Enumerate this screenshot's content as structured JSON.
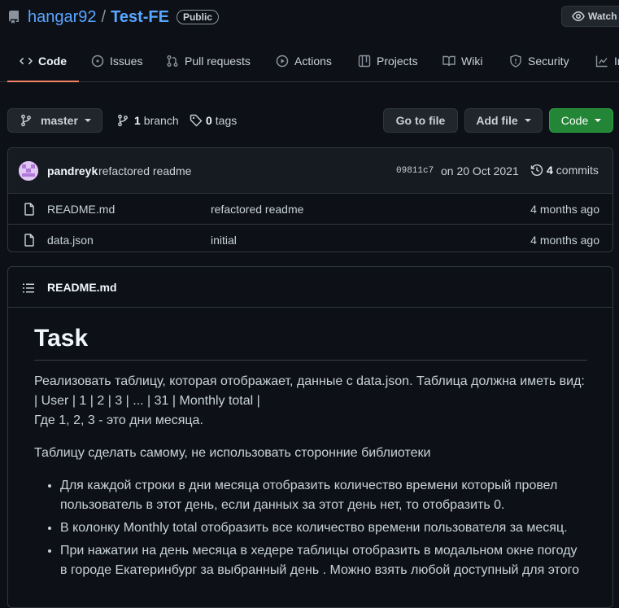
{
  "repo": {
    "owner": "hangar92",
    "separator": "/",
    "name": "Test-FE",
    "visibility": "Public",
    "watch_label": "Watch"
  },
  "tabs": [
    {
      "label": "Code",
      "icon": "code-icon",
      "active": true
    },
    {
      "label": "Issues",
      "icon": "issue-icon"
    },
    {
      "label": "Pull requests",
      "icon": "pull-request-icon"
    },
    {
      "label": "Actions",
      "icon": "play-icon"
    },
    {
      "label": "Projects",
      "icon": "project-icon"
    },
    {
      "label": "Wiki",
      "icon": "book-icon"
    },
    {
      "label": "Security",
      "icon": "shield-icon"
    },
    {
      "label": "In",
      "icon": "graph-icon"
    }
  ],
  "toolbar": {
    "branch_label": "master",
    "branch_count": "1",
    "branch_word": "branch",
    "tag_count": "0",
    "tag_word": "tags",
    "goto_label": "Go to file",
    "addfile_label": "Add file",
    "code_label": "Code"
  },
  "commit": {
    "author": "pandreyk",
    "message": "refactored readme",
    "sha": "09811c7",
    "date": "on 20 Oct 2021",
    "commit_count": "4",
    "commit_word": "commits"
  },
  "files": [
    {
      "name": "README.md",
      "message": "refactored readme",
      "age": "4 months ago"
    },
    {
      "name": "data.json",
      "message": "initial",
      "age": "4 months ago"
    }
  ],
  "readme": {
    "filename": "README.md",
    "heading": "Task",
    "p1_line1": "Реализовать таблицу, которая отображает, данные с data.json. Таблица должна иметь вид:",
    "p1_line2": "| User | 1 | 2 | 3 | ... | 31 | Monthly total |",
    "p1_line3": "Где 1, 2, 3 - это дни месяца.",
    "p2": "Таблицу сделать самому, не использовать сторонние библиотеки",
    "bullets": [
      "Для каждой строки в дни месяца отобразить количество времени который провел пользователь в этот день, если данных за этот день нет, то отобразить 0.",
      "В колонку Monthly total отобразить все количество времени пользователя за месяц.",
      "При нажатии на день месяца в хедере таблицы отобразить в модальном окне погоду в городе Екатеринбург за выбранный день . Можно взять любой доступный для этого"
    ]
  },
  "colors": {
    "background": "#0d1117",
    "link": "#58a6ff",
    "primary_button": "#238636",
    "active_tab_underline": "#f78166"
  }
}
